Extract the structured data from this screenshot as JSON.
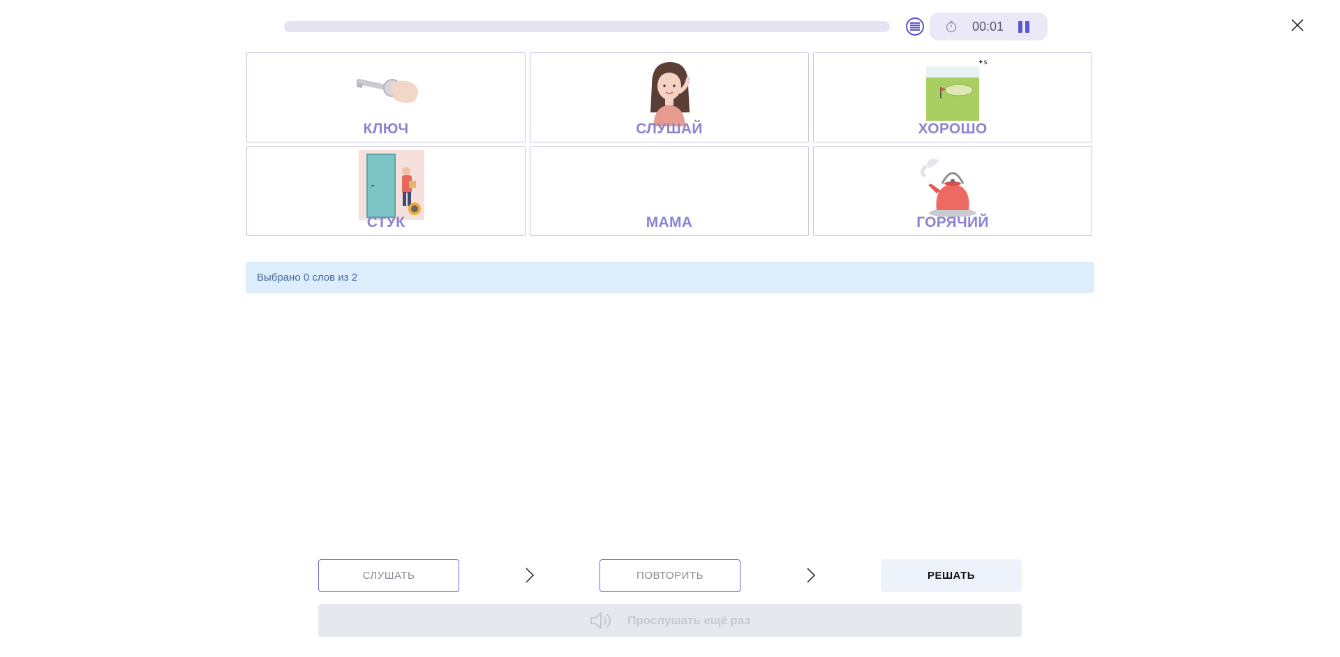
{
  "header": {
    "progress_percent": 0,
    "timer": "00:01"
  },
  "cards": [
    {
      "word": "КЛЮЧ",
      "image": "key-image"
    },
    {
      "word": "СЛУШАЙ",
      "image": "listening-girl-image"
    },
    {
      "word": "ХОРОШО",
      "image": "golf-field-image"
    },
    {
      "word": "СТУК",
      "image": "door-knock-image"
    },
    {
      "word": "МАМА",
      "image": ""
    },
    {
      "word": "ГОРЯЧИЙ",
      "image": "hot-kettle-image"
    }
  ],
  "status": {
    "text": "Выбрано 0 слов из 2"
  },
  "steps": {
    "listen_label": "СЛУШАТЬ",
    "repeat_label": "ПОВТОРИТЬ",
    "solve_label": "РЕШАТЬ"
  },
  "replay": {
    "label": "Прослушать ещё раз"
  },
  "colors": {
    "accent": "#5b57d1",
    "card_word": "#8a84cf",
    "status_bg": "#dcedfc"
  }
}
